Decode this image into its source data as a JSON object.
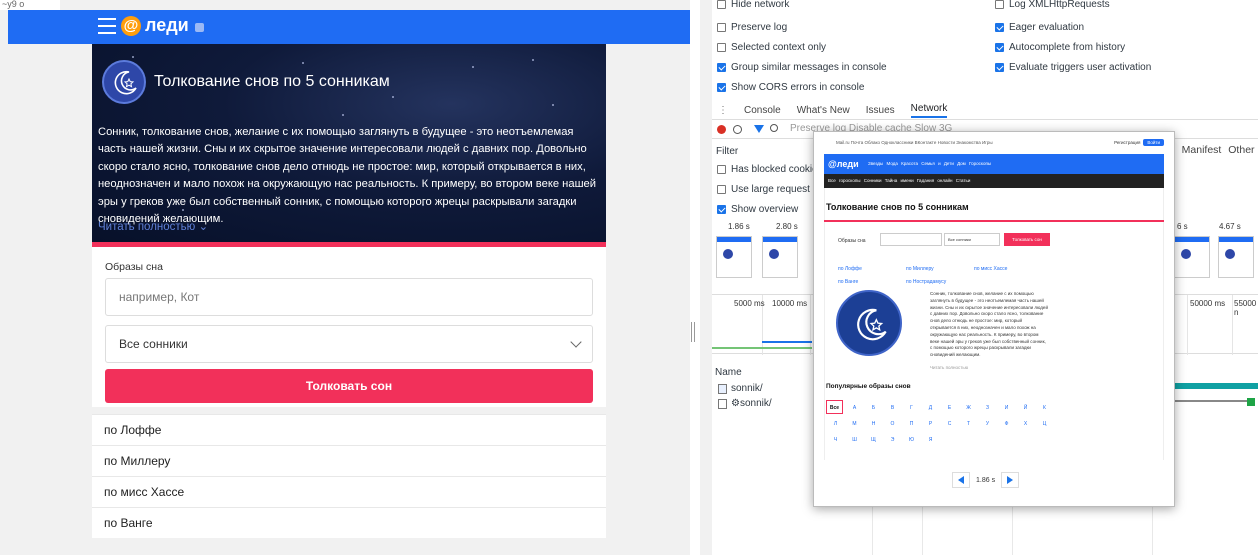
{
  "left": {
    "corner_label": "~у9 о",
    "logo_text": "леди",
    "hero": {
      "title": "Толкование снов по 5 сонникам",
      "text": "Сонник, толкование снов, желание с их помощью заглянуть в будущее - это неотъемлемая часть нашей жизни. Сны и их скрытое значение интересовали людей с давних пор. Довольно скоро стало ясно, толкование снов дело отнюдь не простое: мир, который открывается в них, неоднозначен и мало похож на окружающую нас реальность. К примеру, во втором веке нашей эры у греков уже был собственный сонник, с помощью которого жрецы раскрывали загадки сновидений желающим.",
      "read_more": "Читать полностью"
    },
    "form": {
      "label": "Образы сна",
      "input_placeholder": "например, Кот",
      "select_value": "Все сонники",
      "submit": "Толковать сон"
    },
    "sonniks": [
      "по Лоффе",
      "по Миллеру",
      "по мисс Хассе",
      "по Ванге"
    ]
  },
  "devtools": {
    "settings_left": [
      {
        "label": "Hide network",
        "checked": false
      },
      {
        "label": "Preserve log",
        "checked": false
      },
      {
        "label": "Selected context only",
        "checked": false
      },
      {
        "label": "Group similar messages in console",
        "checked": true
      },
      {
        "label": "Show CORS errors in console",
        "checked": true
      }
    ],
    "settings_right": [
      {
        "label": "Log XMLHttpRequests",
        "checked": false
      },
      {
        "label": "Eager evaluation",
        "checked": true
      },
      {
        "label": "Autocomplete from history",
        "checked": true
      },
      {
        "label": "Evaluate triggers user activation",
        "checked": true
      }
    ],
    "tabs": [
      "Console",
      "What's New",
      "Issues",
      "Network"
    ],
    "toolbar_text": "Preserve log   Disable cache   Slow 3G",
    "filter_label": "Filter",
    "manifest_tabs": "m Manifest Other",
    "options": [
      {
        "label": "Has blocked cookies",
        "checked": false
      },
      {
        "label": "Use large request rows",
        "checked": false
      },
      {
        "label": "Show overview",
        "checked": true
      }
    ],
    "frame_times": [
      "1.86 s",
      "2.80 s",
      "6 s",
      "4.67 s"
    ],
    "ticks": [
      "5000 ms",
      "10000 ms",
      "50000 ms",
      "55000 n"
    ],
    "name_header": "Name",
    "requests": [
      "sonnik/",
      "sonnik/"
    ]
  },
  "overlay": {
    "top_links": "Mail.ru  Почта  Облако  Одноклассники  ВКонтакте  Новости  Знакомства  Игры",
    "login": "Регистрация",
    "login_btn": "Войти",
    "logo": "@леди",
    "nav": "Звезды  Мода  Красота  Семья и Дети  Дом  Гороскопы",
    "subnav": "Все гороскопы   Сонники   Тайна имени   Гадания онлайн   Статьи",
    "title": "Толкование снов по 5 сонникам",
    "form_label": "Образы сна",
    "select": "Все сонники",
    "button": "Толковать сон",
    "links": [
      "по Лоффе",
      "по Миллеру",
      "по мисс Хассе",
      "по Ванге",
      "по Нострадамусу"
    ],
    "article": "Сонник, толкование снов, желание с их помощью заглянуть в будущее - это неотъемлемая часть нашей жизни. Сны и их скрытое значение интересовали людей с давних пор. Довольно скоро стало ясно, толкование снов дело отнюдь не простое: мир, который открывается в них, неоднозначен и мало похож на окружающую нас реальность. К примеру, во втором веке нашей эры у греков уже был собственный сонник, с помощью которого жрецы раскрывали загадки сновидений желающим.",
    "read_more": "Читать полностью",
    "popular": "Популярные образы снов",
    "letters": [
      "Все",
      "А",
      "Б",
      "В",
      "Г",
      "Д",
      "Е",
      "Ж",
      "З",
      "И",
      "Й",
      "К",
      "Л",
      "М",
      "Н",
      "О",
      "П",
      "Р",
      "С",
      "Т",
      "У",
      "Ф",
      "Х",
      "Ц",
      "Ч",
      "Ш",
      "Щ",
      "Э",
      "Ю",
      "Я"
    ],
    "pager_time": "1.86 s"
  }
}
